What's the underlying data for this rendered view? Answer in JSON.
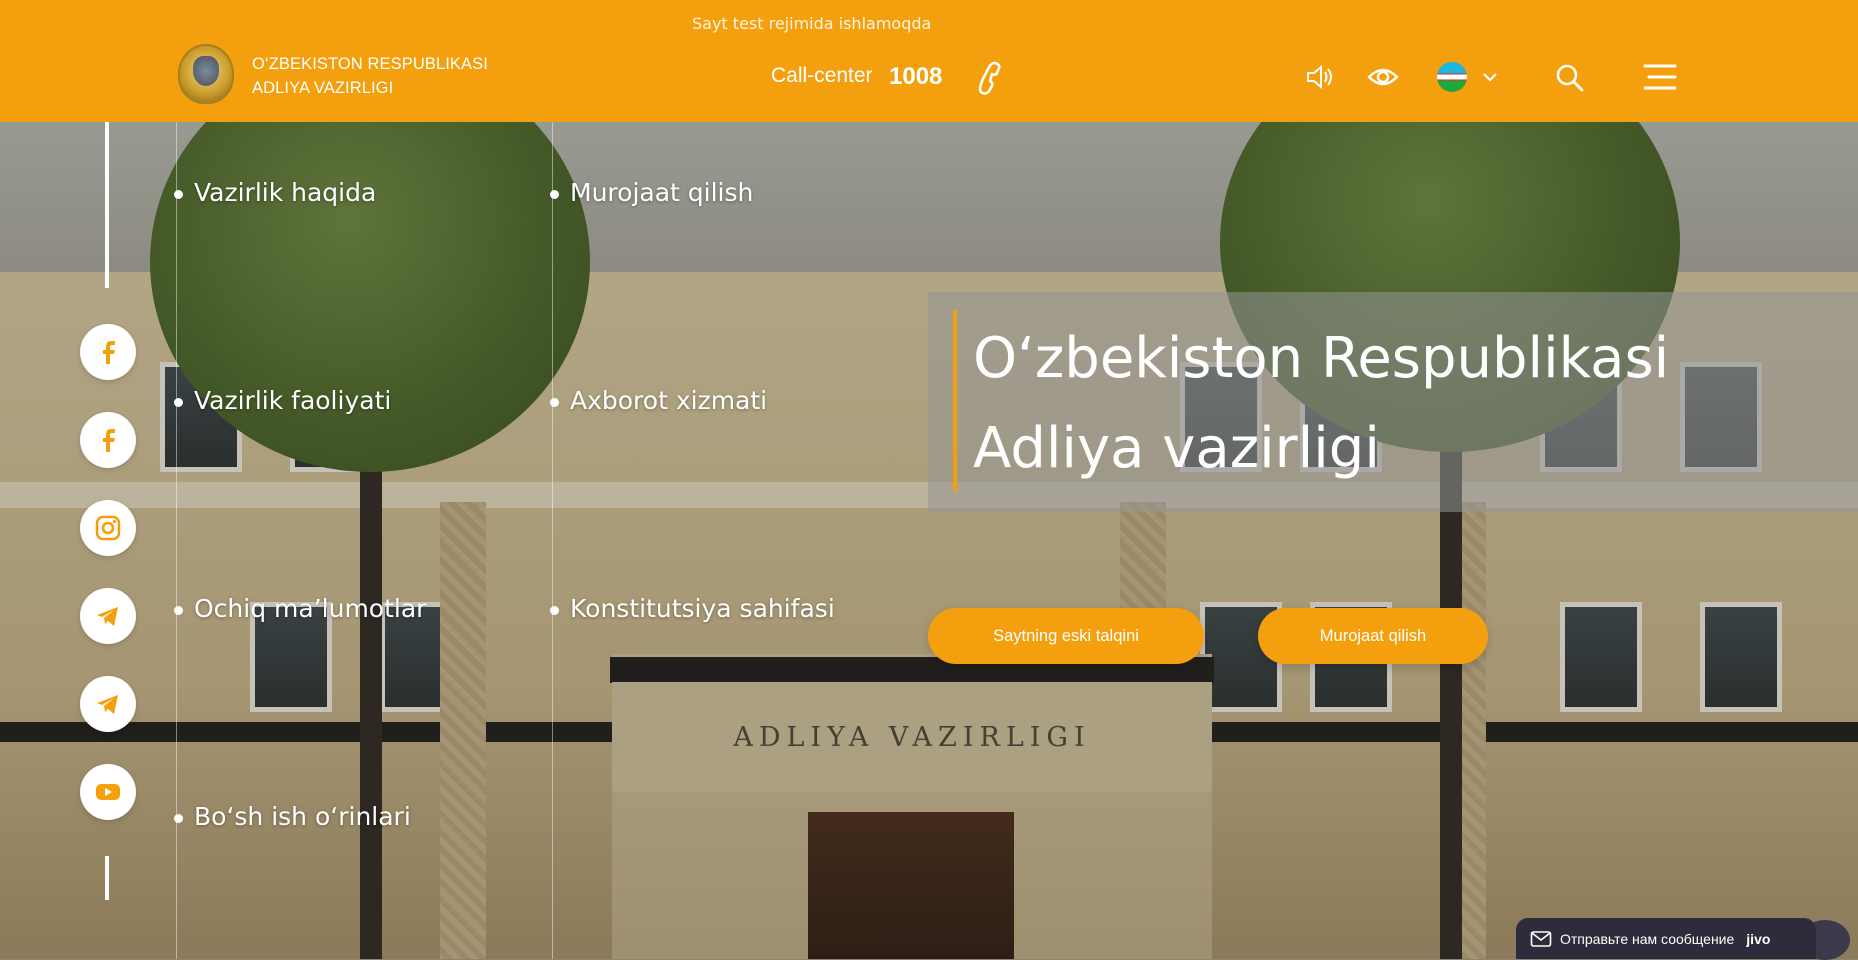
{
  "header": {
    "test_banner": "Sayt test rejimida ishlamoqda",
    "logo_line1": "O‘ZBEKISTON RESPUBLIKASI",
    "logo_line2": "ADLIYA VAZIRLIGI",
    "callcenter_label": "Call-center",
    "callcenter_number": "1008",
    "icons": [
      "volume-icon",
      "eye-icon",
      "uz-flag-icon",
      "chevron-down-icon",
      "search-icon",
      "menu-icon"
    ]
  },
  "menu": {
    "items": [
      "Vazirlik haqida",
      "Murojaat qilish",
      "Vazirlik faoliyati",
      "Axborot xizmati",
      "Ochiq ma’lumotlar",
      "Konstitutsiya sahifasi",
      "Bo‘sh ish o‘rinlari"
    ]
  },
  "social": [
    "facebook-icon",
    "facebook-icon",
    "instagram-icon",
    "telegram-icon",
    "telegram-icon",
    "youtube-icon"
  ],
  "hero": {
    "title_line1": "O‘zbekiston Respublikasi",
    "title_line2": "Adliya vazirligi",
    "building_sign": "ADLIYA VAZIRLIGI",
    "button_old_site": "Saytning eski talqini",
    "button_appeal": "Murojaat qilish"
  },
  "chat": {
    "label": "Отправьте нам сообщение",
    "brand": "jivo"
  },
  "colors": {
    "accent": "#f4a00e",
    "title_box": "#969696",
    "chat_bg": "#2c2c3a"
  }
}
